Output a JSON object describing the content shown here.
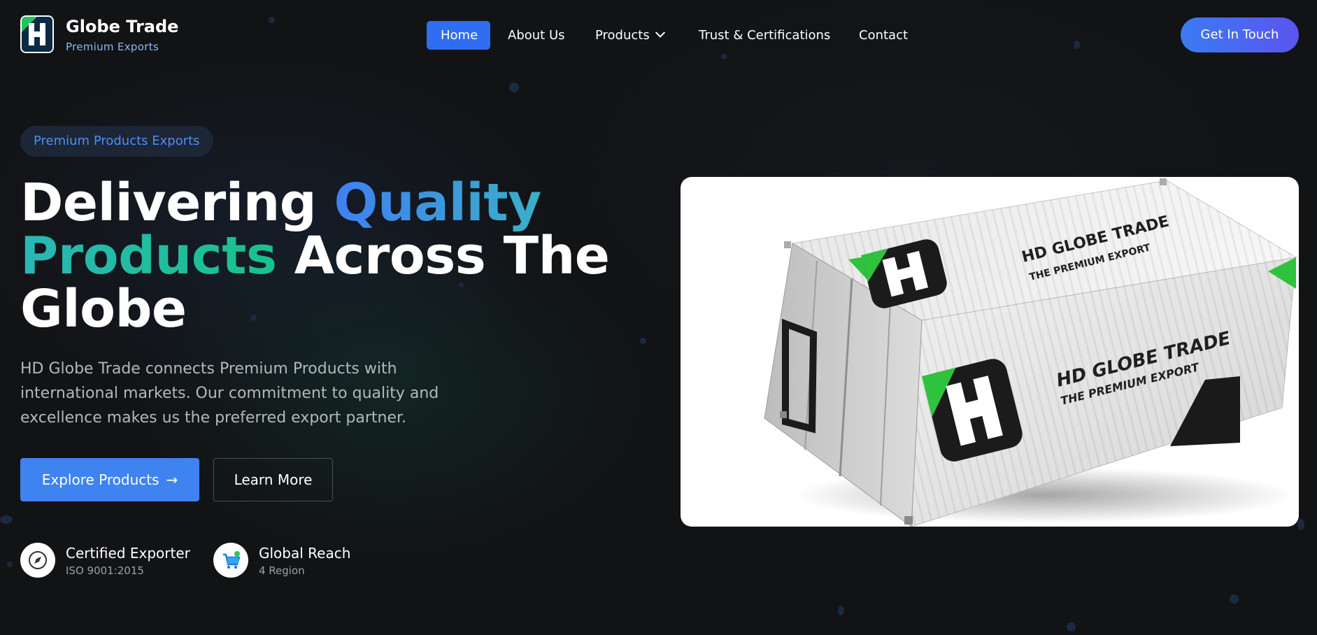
{
  "brand": {
    "name": "Globe Trade",
    "tagline": "Premium Exports"
  },
  "nav": {
    "items": [
      {
        "label": "Home",
        "active": true
      },
      {
        "label": "About Us"
      },
      {
        "label": "Products",
        "has_dropdown": true
      },
      {
        "label": "Trust & Certifications"
      },
      {
        "label": "Contact"
      }
    ],
    "cta_label": "Get In Touch"
  },
  "hero": {
    "pill": "Premium Products Exports",
    "headline": {
      "part1": "Delivering ",
      "highlight1": "Quality",
      "highlight2": "Products",
      "part2": " Across The Globe"
    },
    "description": "HD Globe Trade connects Premium Products with international markets. Our commitment to quality and excellence makes us the preferred export partner.",
    "primary_button": "Explore Products",
    "secondary_button": "Learn More"
  },
  "badges": [
    {
      "title": "Certified Exporter",
      "subtitle": "ISO 9001:2015",
      "icon": "compass-icon"
    },
    {
      "title": "Global Reach",
      "subtitle": "4 Region",
      "icon": "shopping-cart-icon"
    }
  ],
  "product_image": {
    "container_text_top": "HD GLOBE TRADE",
    "container_subtext_top": "THE PREMIUM EXPORT",
    "container_text_side": "HD GLOBE TRADE",
    "container_subtext_side": "THE PREMIUM EXPORT"
  },
  "colors": {
    "background": "#121315",
    "accent_blue": "#2f6ef2",
    "accent_green": "#18c28c",
    "pill_text": "#4f8ef2"
  }
}
